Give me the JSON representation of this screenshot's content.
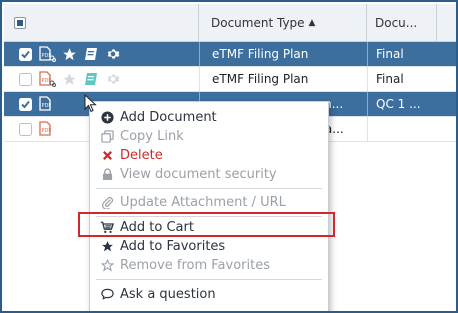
{
  "header": {
    "document_type_label": "Document Type",
    "sort_indicator": "▲",
    "document_label": "Docu..."
  },
  "rows": [
    {
      "selected": true,
      "type": "eTMF Filing Plan",
      "doc": "Final"
    },
    {
      "selected": false,
      "type": "eTMF Filing Plan",
      "doc": "Final"
    },
    {
      "selected": true,
      "type": "m...",
      "doc": "QC 1 ..."
    },
    {
      "selected": false,
      "type": "ra...",
      "doc": ""
    }
  ],
  "menu": {
    "add_document": "Add Document",
    "copy_link": "Copy Link",
    "delete": "Delete",
    "view_security": "View document security",
    "update_attachment": "Update Attachment / URL",
    "add_to_cart": "Add to Cart",
    "add_to_favorites": "Add to Favorites",
    "remove_from_favorites": "Remove from Favorites",
    "ask_question": "Ask a question"
  },
  "colors": {
    "selected_row": "#3c6e9e",
    "highlight_box": "#d3282b",
    "delete_red": "#cc2a2a",
    "frame_border": "#2c5d8a"
  }
}
